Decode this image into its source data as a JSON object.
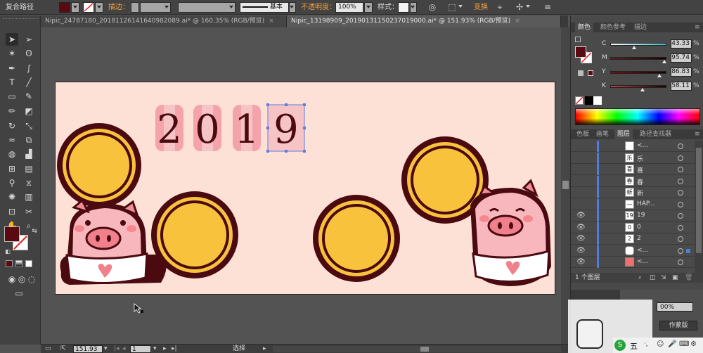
{
  "control_bar": {
    "selection_label": "复合路径",
    "fill_color": "#5a0a10",
    "stroke_label": "描边：",
    "stroke_style": "基本",
    "opacity_label": "不透明度：",
    "opacity_value": "100%",
    "style_label": "样式：",
    "transform_label": "变换"
  },
  "tabs": [
    {
      "label": "Nipic_24787180_20181126141640982089.ai* @ 160.35% (RGB/预览)",
      "close": "×"
    },
    {
      "label": "Nipic_13198909_20190131150237019000.ai* @ 151.93% (RGB/预览)",
      "close": "×"
    }
  ],
  "tools": [
    "selection-tool",
    "direct-selection-tool",
    "magic-wand-tool",
    "lasso-tool",
    "pen-tool",
    "curvature-tool",
    "type-tool",
    "line-tool",
    "rectangle-tool",
    "paintbrush-tool",
    "pencil-tool",
    "eraser-tool",
    "rotate-tool",
    "scale-tool",
    "warp-tool",
    "free-transform-tool",
    "shape-builder-tool",
    "perspective-tool",
    "mesh-tool",
    "gradient-tool",
    "eyedropper-tool",
    "blend-tool",
    "symbol-sprayer-tool",
    "graph-tool",
    "artboard-tool",
    "slice-tool",
    "hand-tool",
    "zoom-tool"
  ],
  "artwork": {
    "year_digits": [
      "2",
      "0",
      "1",
      "9"
    ]
  },
  "status_bar": {
    "zoom": "151.93",
    "artboard_number": "1",
    "tool_status": "选择"
  },
  "color_panel": {
    "tabs": [
      "颜色",
      "颜色参考",
      "描边"
    ],
    "channels": [
      {
        "label": "C",
        "value": "43.33",
        "fraction": 0.43,
        "color_from": "#ffffff",
        "color_to": "#3fb8c8"
      },
      {
        "label": "M",
        "value": "95.74",
        "fraction": 0.96,
        "color_from": "#6a2020",
        "color_to": "#1a0000"
      },
      {
        "label": "Y",
        "value": "86.83",
        "fraction": 0.87,
        "color_from": "#7a1010",
        "color_to": "#1a0000"
      },
      {
        "label": "K",
        "value": "58.11",
        "fraction": 0.58,
        "color_from": "#c04040",
        "color_to": "#1a0000"
      }
    ],
    "percent": "%"
  },
  "layers_panel": {
    "tabs": [
      "色板",
      "画笔",
      "图层",
      "路径查找器"
    ],
    "rows": [
      {
        "thumb": "",
        "name": "<...",
        "eye": false
      },
      {
        "thumb": "乐",
        "name": "乐",
        "eye": false
      },
      {
        "thumb": "喜",
        "name": "喜",
        "eye": false
      },
      {
        "thumb": "春",
        "name": "春",
        "eye": false
      },
      {
        "thumb": "新",
        "name": "新",
        "eye": false
      },
      {
        "thumb": "—",
        "name": "HAP...",
        "eye": false
      },
      {
        "thumb": "19",
        "name": "19",
        "eye": true
      },
      {
        "thumb": "0",
        "name": "0",
        "eye": true
      },
      {
        "thumb": "2",
        "name": "2",
        "eye": true
      },
      {
        "thumb": "",
        "name": "<...",
        "eye": true
      },
      {
        "thumb": "",
        "name": "<...",
        "eye": true
      }
    ],
    "footer": "1 个图层"
  },
  "bottom_panel": {
    "opacity_fragment": "00%",
    "mask_label": "作蒙版"
  },
  "taskbar": {
    "ime_label": "五"
  }
}
